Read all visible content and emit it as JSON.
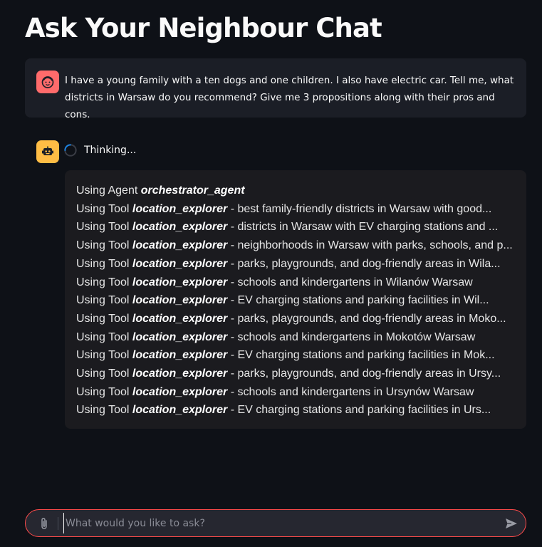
{
  "page": {
    "title": "Ask Your Neighbour Chat"
  },
  "user_message": {
    "avatar_icon": "user-face-icon",
    "avatar_color": "#ff6b6b",
    "text": "I have a young family with a ten dogs and one children. I also have electric car. Tell me, what districts in Warsaw do you recommend? Give me 3 propositions along with their pros and cons."
  },
  "assistant": {
    "avatar_icon": "robot-icon",
    "avatar_color": "#ffbd45",
    "status": "Thinking...",
    "log": [
      {
        "prefix": "Using Agent",
        "name": "orchestrator_agent",
        "detail": ""
      },
      {
        "prefix": "Using Tool",
        "name": "location_explorer",
        "detail": " - best family-friendly districts in Warsaw with good..."
      },
      {
        "prefix": "Using Tool",
        "name": "location_explorer",
        "detail": " - districts in Warsaw with EV charging stations and ..."
      },
      {
        "prefix": "Using Tool",
        "name": "location_explorer",
        "detail": " - neighborhoods in Warsaw with parks, schools, and p..."
      },
      {
        "prefix": "Using Tool",
        "name": "location_explorer",
        "detail": " - parks, playgrounds, and dog-friendly areas in Wila..."
      },
      {
        "prefix": "Using Tool",
        "name": "location_explorer",
        "detail": " - schools and kindergartens in Wilanów Warsaw"
      },
      {
        "prefix": "Using Tool",
        "name": "location_explorer",
        "detail": " - EV charging stations and parking facilities in Wil..."
      },
      {
        "prefix": "Using Tool",
        "name": "location_explorer",
        "detail": " - parks, playgrounds, and dog-friendly areas in Moko..."
      },
      {
        "prefix": "Using Tool",
        "name": "location_explorer",
        "detail": " - schools and kindergartens in Mokotów Warsaw"
      },
      {
        "prefix": "Using Tool",
        "name": "location_explorer",
        "detail": " - EV charging stations and parking facilities in Mok..."
      },
      {
        "prefix": "Using Tool",
        "name": "location_explorer",
        "detail": " - parks, playgrounds, and dog-friendly areas in Ursy..."
      },
      {
        "prefix": "Using Tool",
        "name": "location_explorer",
        "detail": " - schools and kindergartens in Ursynów Warsaw"
      },
      {
        "prefix": "Using Tool",
        "name": "location_explorer",
        "detail": " - EV charging stations and parking facilities in Urs..."
      }
    ]
  },
  "chat_input": {
    "placeholder": "What would you like to ask?",
    "value": "",
    "attach_icon": "paperclip-icon",
    "send_icon": "send-icon",
    "border_color": "#ff4b4b"
  }
}
